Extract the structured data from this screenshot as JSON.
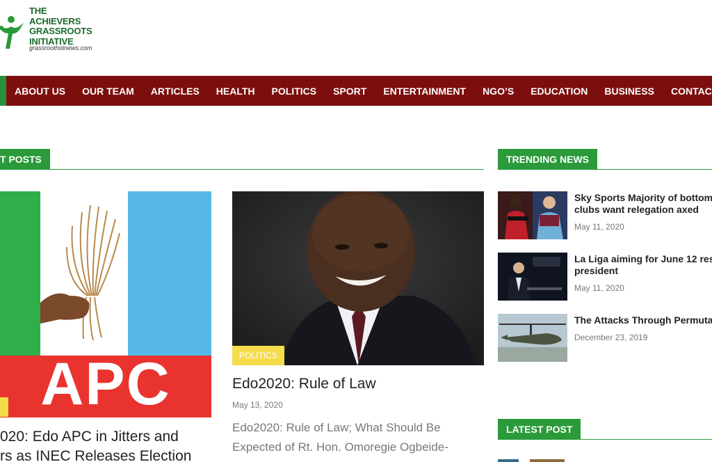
{
  "brand": {
    "line1": "THE",
    "line2": "ACHIEVERS",
    "line3": "GRASSROOTS",
    "line4": "INITIATIVE",
    "url": "grassroothotnews.com"
  },
  "nav": {
    "items": [
      "ABOUT US",
      "OUR TEAM",
      "ARTICLES",
      "HEALTH",
      "POLITICS",
      "SPORT",
      "ENTERTAINMENT",
      "NGO’S",
      "EDUCATION",
      "BUSINESS",
      "CONTACT US"
    ]
  },
  "recent": {
    "tab": "T POSTS",
    "posts": [
      {
        "title_line1": "020: Edo APC in Jitters and",
        "title_line2": "rs as INEC Releases Election",
        "image_text": "APC"
      },
      {
        "category": "POLITICS",
        "title": "Edo2020: Rule of Law",
        "date": "May 13, 2020",
        "excerpt_line1": "Edo2020: Rule of Law; What Should Be",
        "excerpt_line2": "Expected of Rt. Hon. Omoregie Ogbeide-"
      }
    ]
  },
  "trending": {
    "tab": "TRENDING NEWS",
    "items": [
      {
        "title_line1": "Sky Sports Majority of bottom",
        "title_line2": "clubs want relegation axed",
        "date": "May 11, 2020"
      },
      {
        "title_line1": "La Liga aiming for June 12 res",
        "title_line2": "president",
        "date": "May 11, 2020"
      },
      {
        "title_line1": "The Attacks Through Permuta",
        "title_line2": "",
        "date": "December 23, 2019"
      }
    ]
  },
  "latest": {
    "tab": "LATEST POST"
  },
  "colors": {
    "nav_bg": "#7d0e0e",
    "accent_green": "#2a9a3a",
    "badge_yellow": "#f5dc4a"
  }
}
